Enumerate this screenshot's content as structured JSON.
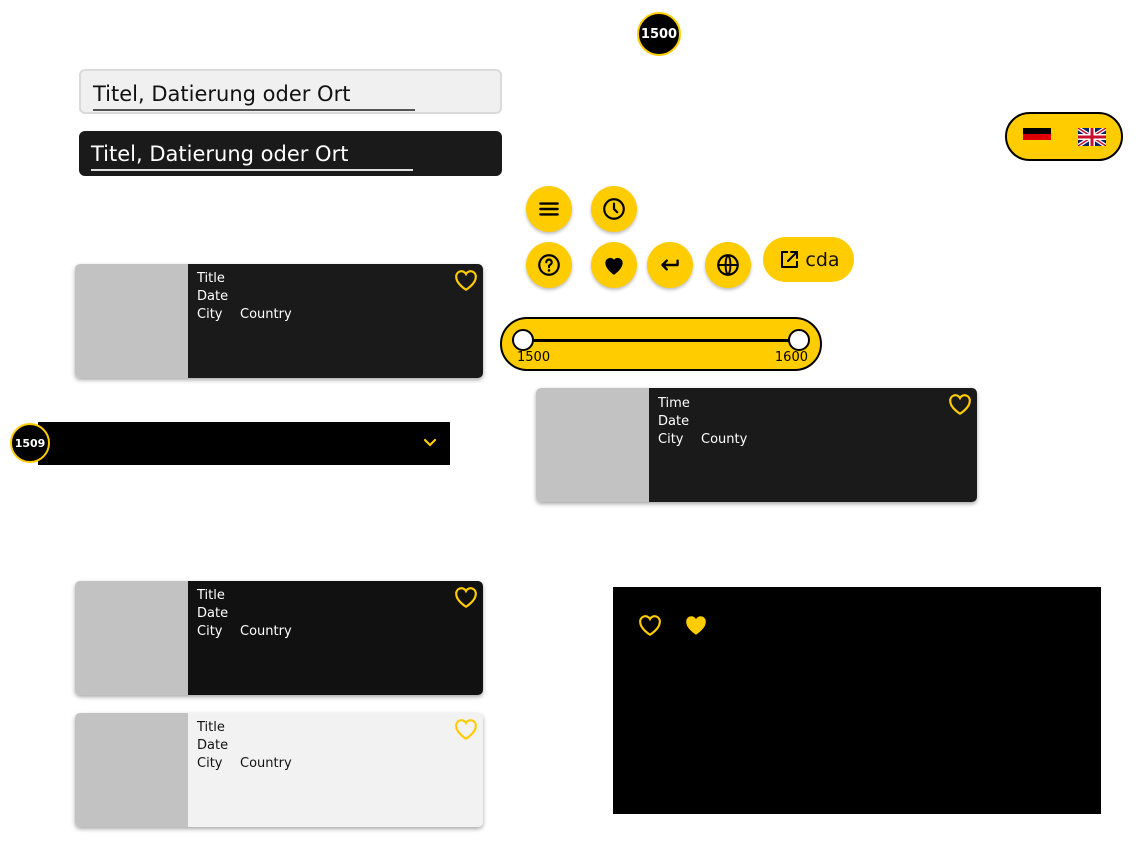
{
  "year_badges": {
    "top": "1500",
    "timeline": "1509"
  },
  "search": {
    "placeholder_light": "Titel, Datierung oder Ort",
    "placeholder_dark": "Titel, Datierung oder Ort"
  },
  "buttons": {
    "menu": "menu-icon",
    "history": "clock-icon",
    "help": "help-icon",
    "favorites": "heart-icon",
    "back": "back-icon",
    "language": "globe-icon",
    "external_label": "cda"
  },
  "language_switch": {
    "options": [
      "German",
      "English"
    ]
  },
  "range_slider": {
    "min_label": "1500",
    "max_label": "1600",
    "min_value": 1500,
    "max_value": 1600
  },
  "cards": [
    {
      "variant": "dark",
      "line1": "Title",
      "line2": "Date",
      "city": "City",
      "country": "Country"
    },
    {
      "variant": "dark",
      "line1": "Time",
      "line2": "Date",
      "city": "City",
      "country": "County"
    },
    {
      "variant": "darker",
      "line1": "Title",
      "line2": "Date",
      "city": "City",
      "country": "Country"
    },
    {
      "variant": "light",
      "line1": "Title",
      "line2": "Date",
      "city": "City",
      "country": "Country"
    }
  ],
  "colors": {
    "accent": "#ffcc00",
    "dark": "#1a1a1a",
    "black": "#000000",
    "placeholder": "#c2c2c2"
  }
}
